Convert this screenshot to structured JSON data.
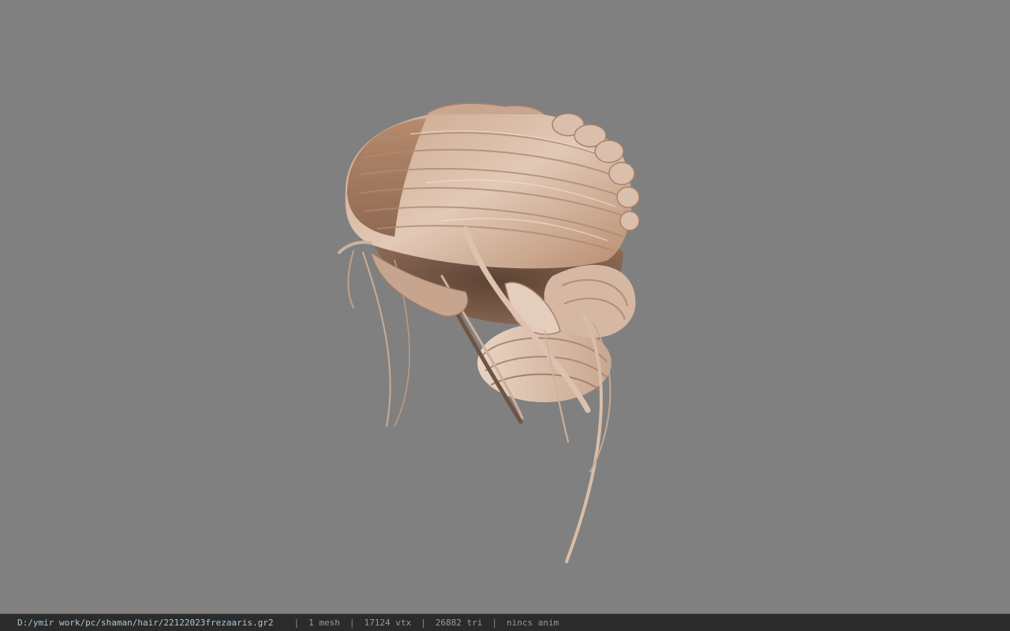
{
  "viewer": {
    "background_color": "#808080",
    "model_icon": "hair-mesh-model"
  },
  "status_bar": {
    "file_path": "D:/ymir work/pc/shaman/hair/22122023frezaaris.gr2",
    "separator": "|",
    "mesh_count": "1 mesh",
    "vertex_count": "17124 vtx",
    "triangle_count": "26882 tri",
    "animation": "nincs anim",
    "path_color": "#a9c9dd",
    "text_color": "#9a9a9a"
  }
}
